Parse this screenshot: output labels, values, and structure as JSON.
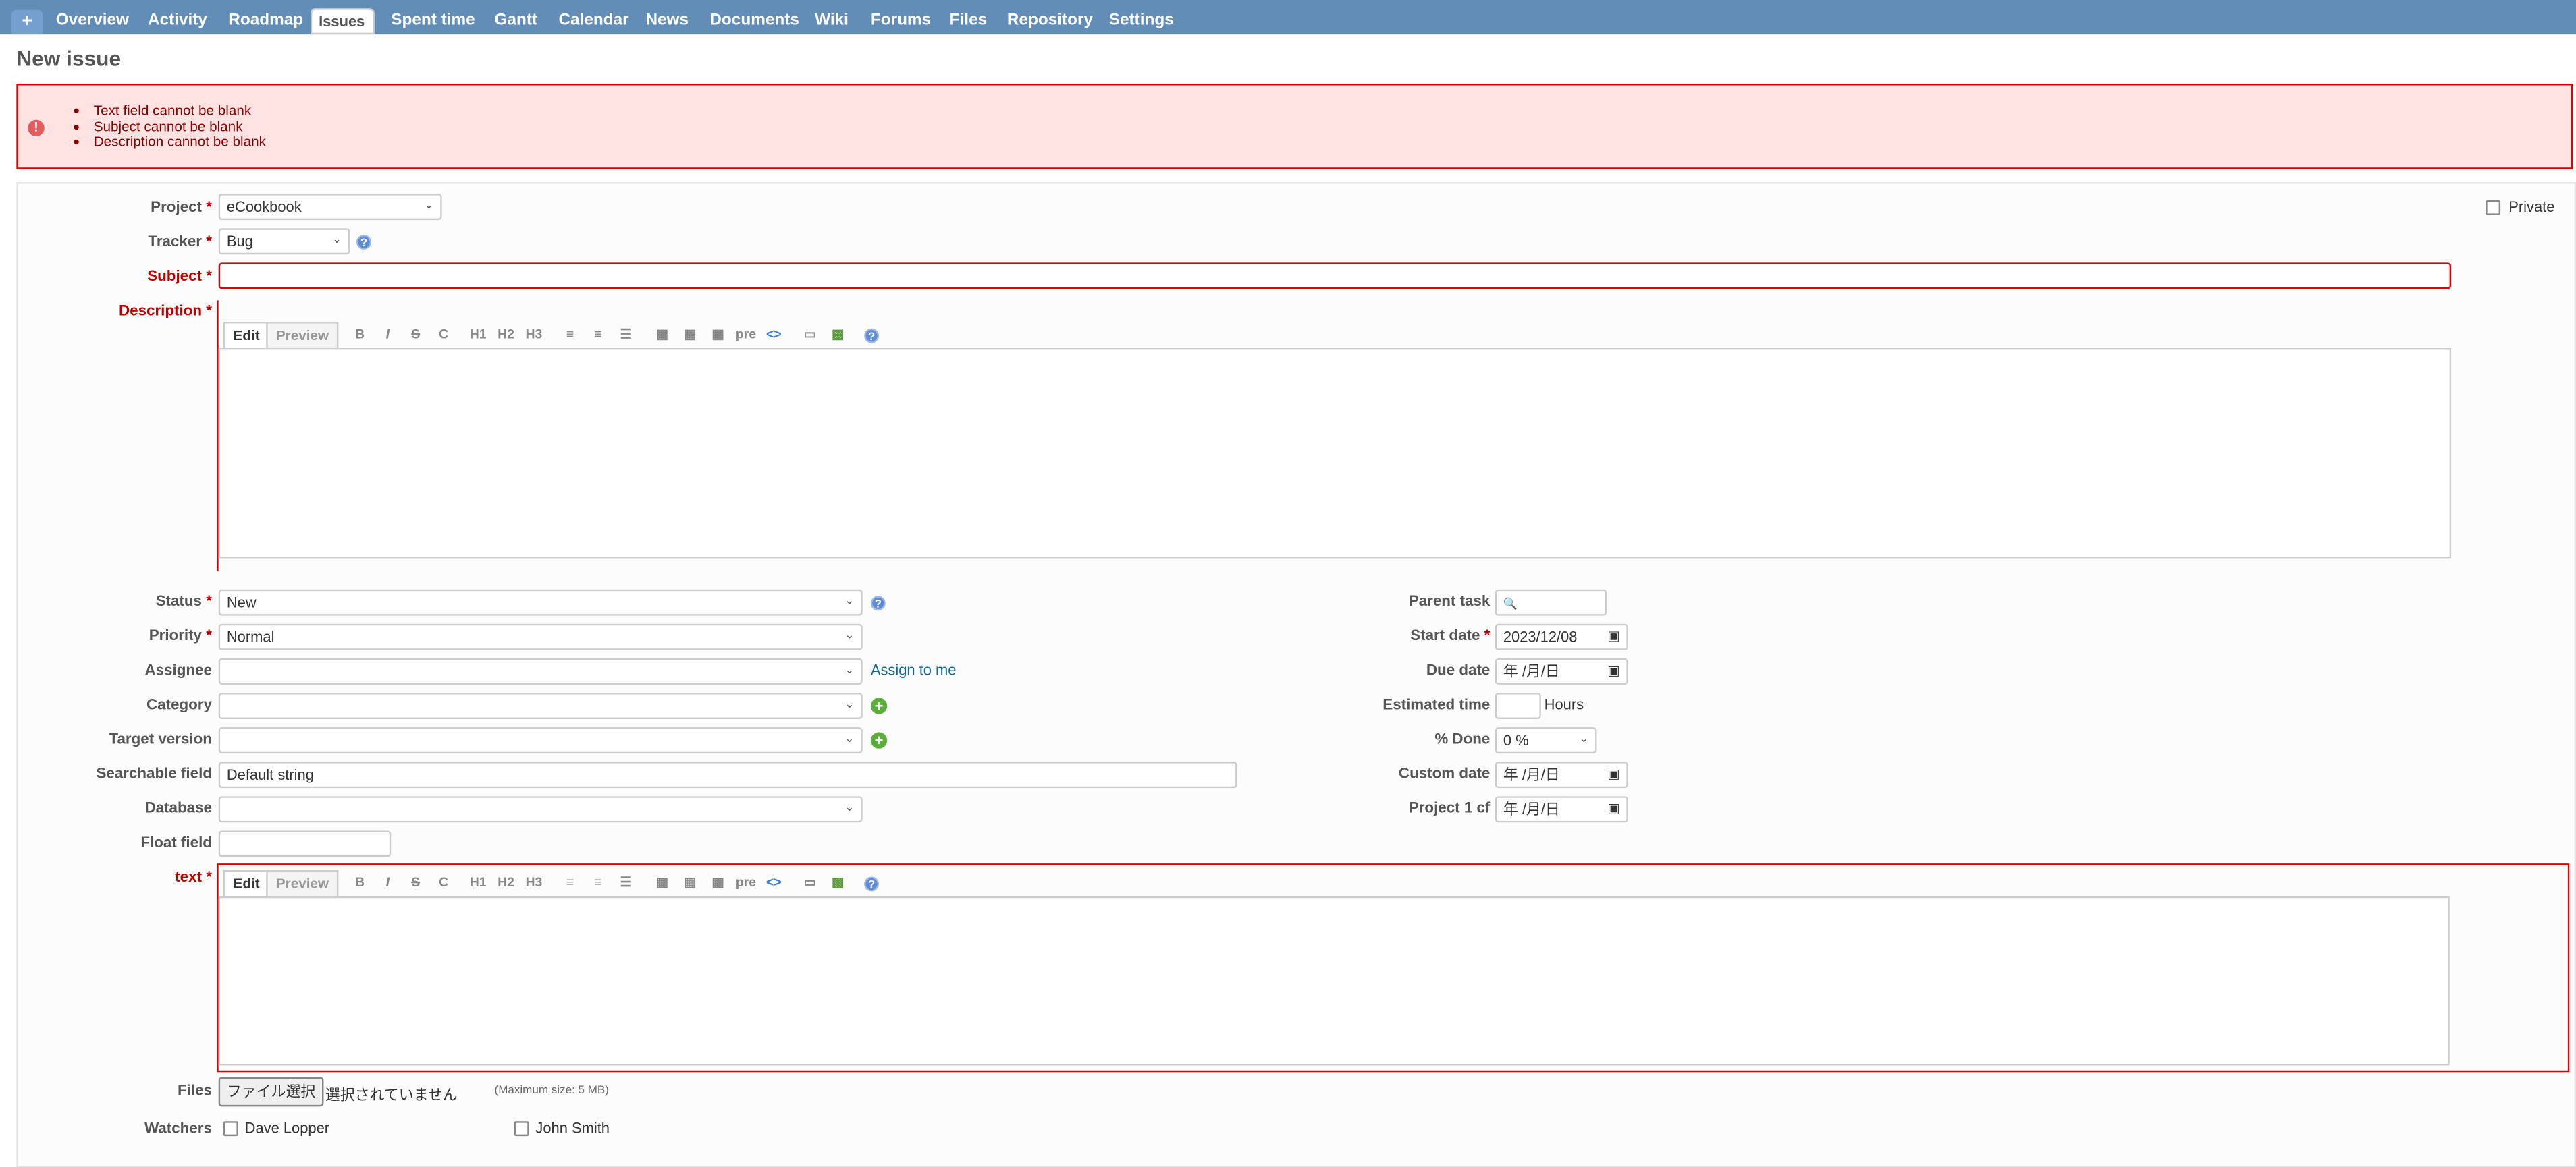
{
  "nav": {
    "plus": "+",
    "tabs": [
      "Overview",
      "Activity",
      "Roadmap",
      "Issues",
      "Spent time",
      "Gantt",
      "Calendar",
      "News",
      "Documents",
      "Wiki",
      "Forums",
      "Files",
      "Repository",
      "Settings"
    ],
    "selected": "Issues"
  },
  "page_title": "New issue",
  "errors": [
    "Text field cannot be blank",
    "Subject cannot be blank",
    "Description cannot be blank"
  ],
  "form": {
    "project": {
      "label": "Project",
      "value": "eCookbook"
    },
    "tracker": {
      "label": "Tracker",
      "value": "Bug"
    },
    "subject": {
      "label": "Subject",
      "value": ""
    },
    "description": {
      "label": "Description"
    },
    "private": {
      "label": "Private",
      "checked": false
    },
    "status": {
      "label": "Status",
      "value": "New"
    },
    "priority": {
      "label": "Priority",
      "value": "Normal"
    },
    "assignee": {
      "label": "Assignee",
      "value": "",
      "assign_to_me": "Assign to me"
    },
    "category": {
      "label": "Category",
      "value": ""
    },
    "target_version": {
      "label": "Target version",
      "value": ""
    },
    "searchable_field": {
      "label": "Searchable field",
      "value": "Default string"
    },
    "database": {
      "label": "Database",
      "value": ""
    },
    "float_field": {
      "label": "Float field",
      "value": ""
    },
    "text": {
      "label": "text"
    },
    "parent_task": {
      "label": "Parent task",
      "value": ""
    },
    "start_date": {
      "label": "Start date",
      "value": "2023/12/08"
    },
    "due_date": {
      "label": "Due date",
      "value": "年 /月/日"
    },
    "estimated_time": {
      "label": "Estimated time",
      "unit": "Hours",
      "value": ""
    },
    "done": {
      "label": "% Done",
      "value": "0 %"
    },
    "custom_date": {
      "label": "Custom date",
      "value": "年 /月/日"
    },
    "project1_cf": {
      "label": "Project 1 cf",
      "value": "年 /月/日"
    },
    "files": {
      "label": "Files",
      "button": "ファイル選択",
      "status": "選択されていません",
      "max": "(Maximum size: 5 MB)"
    },
    "watchers": {
      "label": "Watchers",
      "people": [
        "Dave Lopper",
        "John Smith"
      ]
    }
  },
  "editor": {
    "tab_edit": "Edit",
    "tab_preview": "Preview",
    "buttons": [
      "B",
      "I",
      "S",
      "C",
      "H1",
      "H2",
      "H3",
      "ul",
      "ol",
      "tl",
      "indent-right",
      "indent-left",
      "table",
      "pre",
      "<>",
      "img",
      "image",
      "help"
    ]
  }
}
